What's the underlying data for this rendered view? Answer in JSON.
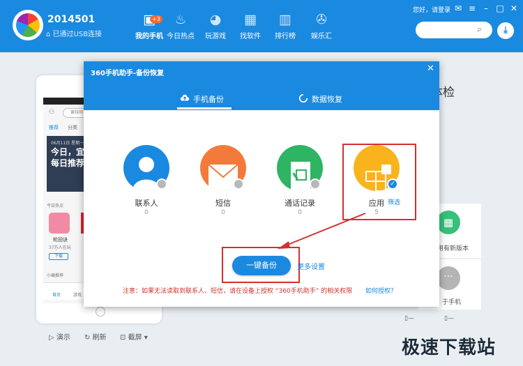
{
  "header": {
    "device_name": "2014501",
    "connection_status": "已通过USB连接",
    "login_text": "您好，请登录",
    "nav": [
      {
        "label": "我的手机",
        "icon": "phone-icon",
        "badge": "+3"
      },
      {
        "label": "今日热点",
        "icon": "flame-icon"
      },
      {
        "label": "玩游戏",
        "icon": "pacman-icon"
      },
      {
        "label": "找软件",
        "icon": "apps-grid-icon"
      },
      {
        "label": "排行榜",
        "icon": "bar-chart-icon"
      },
      {
        "label": "娱乐汇",
        "icon": "film-reel-icon"
      }
    ]
  },
  "phone_preview": {
    "search_text": "黄晓明",
    "tabs": [
      "推荐",
      "分类"
    ],
    "banner_date": "06月11日 星期一",
    "banner_line1": "今日，宜天",
    "banner_line2": "每日推荐",
    "section_label": "今日热点",
    "app_name": "轮回诀",
    "app_count": "37万人在玩",
    "download_label": "下载",
    "section2_label": "小编推荐",
    "nav_home": "首页",
    "nav_game": "游戏"
  },
  "bottom_tools": {
    "demo": "演示",
    "refresh": "刷新",
    "screenshot": "截屏"
  },
  "background": {
    "title_fragment": "体检",
    "card1_text": "用有新版本",
    "card2_text": "于手机",
    "battery_label": "—"
  },
  "dialog": {
    "title": "360手机助手-备份恢复",
    "tabs": [
      {
        "label": "手机备份",
        "active": true
      },
      {
        "label": "数据恢复",
        "active": false
      }
    ],
    "categories": [
      {
        "label": "联系人",
        "count": "0",
        "color": "#1a89e0",
        "checked": false
      },
      {
        "label": "短信",
        "count": "0",
        "color": "#f47a3c",
        "checked": false
      },
      {
        "label": "通话记录",
        "count": "0",
        "color": "#2eb463",
        "checked": false
      },
      {
        "label": "应用",
        "count": "5",
        "color": "#f9b31d",
        "checked": true
      }
    ],
    "filter_label": "筛选",
    "backup_button": "一键备份",
    "more_settings": "更多设置",
    "notice": "注意：如果无法读取到联系人、短信，请在设备上授权 “360手机助手” 的相关权限",
    "auth_link": "如何授权？"
  },
  "watermark": "极速下载站",
  "colors": {
    "primary": "#1a89e0",
    "annotation_red": "#d32f2f",
    "notice_red": "#d0352f"
  }
}
